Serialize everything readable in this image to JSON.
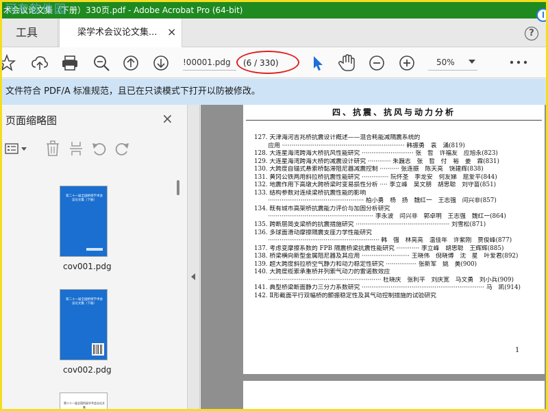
{
  "window": {
    "title": "术会议论文集（下册）330页.pdf - Adobe Acrobat Pro (64-bit)"
  },
  "watermarks": {
    "top": "河东软件园",
    "bottom": "www.cndao.com"
  },
  "tabs": {
    "tools": "工具",
    "document": "梁学术会议论文集...",
    "close": "×",
    "help": "?"
  },
  "toolbar": {
    "page_name": "!00001.pdg",
    "page_number": "(6 / 330)",
    "zoom": "50%"
  },
  "notice": {
    "text": "文件符合 PDF/A 标准规范，且已在只读模式下打开以防被修改。"
  },
  "panel": {
    "title": "页面缩略图",
    "close": "×",
    "thumbnails": [
      {
        "caption": "cov001.pdg",
        "cover_title": "第二十一届全国桥梁学术会议论文集（下册）"
      },
      {
        "caption": "cov002.pdg",
        "cover_title": "第二十一届全国桥梁学术会议论文集（下册）"
      },
      {
        "caption": "",
        "cover_title": "第二十一届全国桥梁学术会议论文集"
      }
    ]
  },
  "document": {
    "heading": "四、抗震、抗风与动力分析",
    "page_number": "1",
    "entries": [
      "127. 天津海河吉兆桥抗震设计概述——混合耗能减隔震系统的",
      "　　 应用 ································································ 韩振勇　袁　涌(819)",
      "128. 大连星海湾跨海大桥抗风性能研究 ··························· 张　哲　许福友　应旭永(823)",
      "129. 大连星海湾跨海大桥的减震设计研究 ············ 朱巍志　张　哲　付　裕　姜　霖(831)",
      "130. 大跨度自锚式悬索桥黏滞阻尼器减震控制 ·········· 张连振　陈天亮　饶建辉(838)",
      "131. 黄冈公铁两用斜拉桥抗震性能研究 ·············· 阮怀圣　李龙安　何友娣　屈爱平(844)",
      "132. 地震作用下高墩大跨桥梁时变易损性分析 ···· 李立峰　吴文朋　胡思聪　刘守苗(851)",
      "133. 结构参数对连续梁桥抗震性能的影响",
      "　　 ·················································· 柏小勇　杨　扬　魏红一　王志强　闫兴非(857)",
      "134. 既有城市高架桥抗震能力评价与加固分析研究",
      "　　 ······················································· 李永波　闫兴非　郭卓明　王志强　魏红一(864)",
      "135. 跨断层简支梁桥的抗震措施研究 ················································· 刘雪松(871)",
      "136. 多球面滑动摩擦隔震支座力学性能研究",
      "　　 ·························································· 韩　强　林亮亮　温佳年　许紫刚　贾俊峰(877)",
      "137. 考虑变摩擦系数的 FPB 隔震桥梁抗震性能研究 ············ 李立峰　胡思聪　王辉辉(885)",
      "138. 桥梁横向新型金属阻尼器及其应用 ························· 王晓伟　倪晓博　沈　星　叶爱君(892)",
      "139. 超大跨度斜拉桥空气静力和动力稳定性研究 ················ 张新军　姚　美(900)",
      "140. 大跨度缆索承重桥并列索气动力的雷诺数效应",
      "　　 ··························································· 杜晓庆　张利平　刘庆宽　马文勇　刘小兵(909)",
      "141. 典型桥梁断面静力三分力系数研究 ································································ 马　凯(914)",
      "142. Ⅱ形截面平行双幅桥的颤振稳定性及其气动控制措施的试验研究"
    ]
  }
}
